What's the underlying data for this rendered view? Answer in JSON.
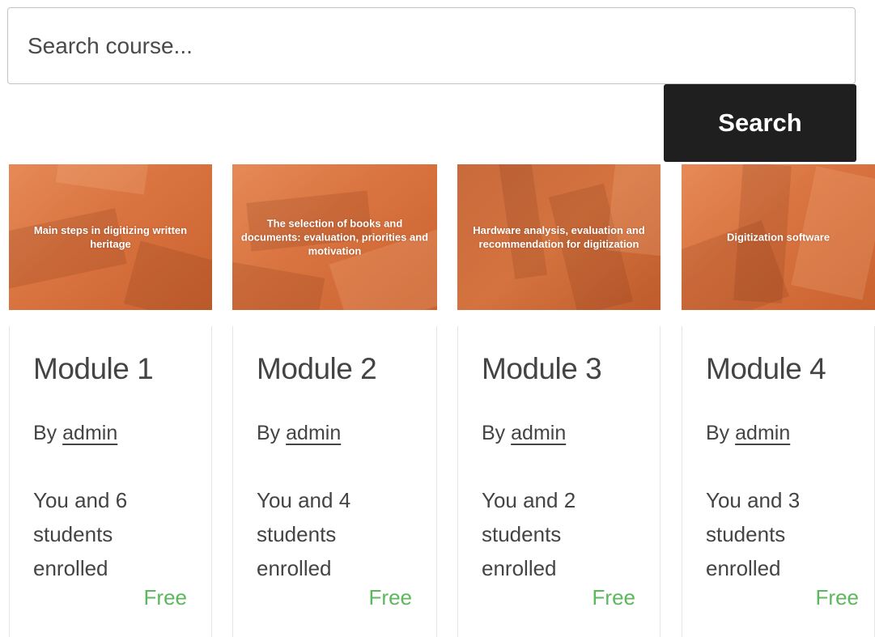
{
  "search": {
    "placeholder": "Search course...",
    "value": "",
    "button_label": "Search"
  },
  "courses": [
    {
      "thumbnail_text": "Main steps in digitizing written heritage",
      "title": "Module 1",
      "author_prefix": "By",
      "author": "admin",
      "enrollment": "You and 6 students enrolled",
      "price": "Free"
    },
    {
      "thumbnail_text": "The selection of books and documents: evaluation, priorities and motivation",
      "title": "Module 2",
      "author_prefix": "By",
      "author": "admin",
      "enrollment": "You and 4 students enrolled",
      "price": "Free"
    },
    {
      "thumbnail_text": "Hardware analysis, evaluation and recommendation for digitization",
      "title": "Module 3",
      "author_prefix": "By",
      "author": "admin",
      "enrollment": "You and 2 students enrolled",
      "price": "Free"
    },
    {
      "thumbnail_text": "Digitization software",
      "title": "Module 4",
      "author_prefix": "By",
      "author": "admin",
      "enrollment": "You and 3 students enrolled",
      "price": "Free"
    }
  ],
  "colors": {
    "search_button_bg": "#1f1f1f",
    "thumbnail_orange": "#d9733f",
    "price_green": "#5cb85c",
    "text_gray": "#444444"
  }
}
